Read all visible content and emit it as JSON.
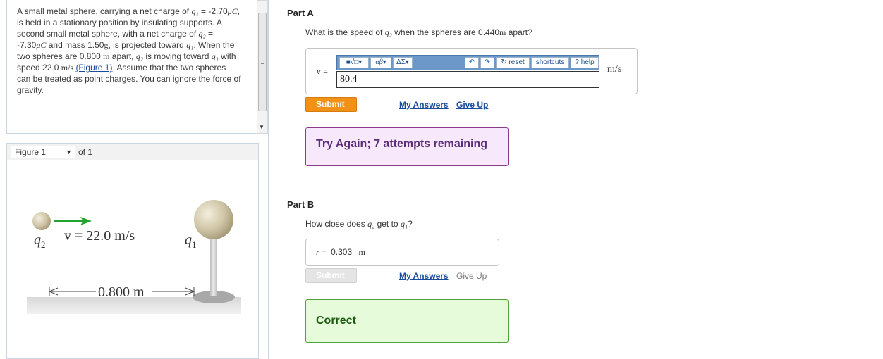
{
  "problem": {
    "p1_a": "A small metal sphere, carrying a net charge of",
    "q1_sym": "q₁",
    "eq1": "=",
    "q1_val": "-2.70",
    "uC": "μC",
    "p1_b": ", is held in a stationary position by insulating supports. A second small metal sphere, with a net charge of",
    "q2_sym": "q₂",
    "eq2": "=",
    "q2_val": "-7.30",
    "p1_c": "and mass",
    "mass_val": "1.50",
    "mass_unit": "g",
    "p1_d": ", is projected toward",
    "p1_e": ". When the two spheres are",
    "dist_val": "0.800",
    "dist_unit": "m",
    "p1_f": "apart,",
    "p1_g": "is moving toward",
    "p1_h": "with speed",
    "speed_val": "22.0",
    "speed_unit": "m/s",
    "figure_link": "(Figure 1)",
    "p1_i": ". Assume that the two spheres can be treated as point charges. You can ignore the force of gravity."
  },
  "figure": {
    "selector_label": "Figure 1",
    "of_label": "of 1",
    "q2_label": "q",
    "q2_sub": "2",
    "q1_label": "q",
    "q1_sub": "1",
    "velocity_label": "v = 22.0 m/s",
    "distance_label": "0.800 m"
  },
  "part_a": {
    "title": "Part A",
    "question_pre": "What is the speed of",
    "question_sym": "q₂",
    "question_mid": "when the spheres are",
    "question_val": "0.440",
    "question_unit": "m",
    "question_post": "apart?",
    "var_label": "v =",
    "toolbar": {
      "templates": "■√□",
      "greek": "αβ",
      "symbols": "ΔΣ",
      "reset": "reset",
      "shortcuts": "shortcuts",
      "help": "help"
    },
    "answer_value": "80.4",
    "unit": "m/s",
    "submit_label": "Submit",
    "my_answers_label": "My Answers",
    "give_up_label": "Give Up",
    "feedback": "Try Again; 7 attempts remaining"
  },
  "part_b": {
    "title": "Part B",
    "question_pre": "How close does",
    "question_sym": "q₂",
    "question_mid": "get to",
    "question_sym2": "q₁",
    "question_post": "?",
    "answer_label": "r =",
    "answer_value": "0.303",
    "answer_unit": "m",
    "submit_label": "Submit",
    "my_answers_label": "My Answers",
    "give_up_label": "Give Up",
    "feedback": "Correct"
  },
  "colors": {
    "orange_submit": "#f29117",
    "disabled_submit": "#e4e4e4",
    "try_again_bg": "#f7e8fb",
    "try_again_border": "#8c3b8c",
    "correct_bg": "#e6fbd9",
    "correct_border": "#4fa33a",
    "toolbar_blue": "#6b98c9"
  }
}
